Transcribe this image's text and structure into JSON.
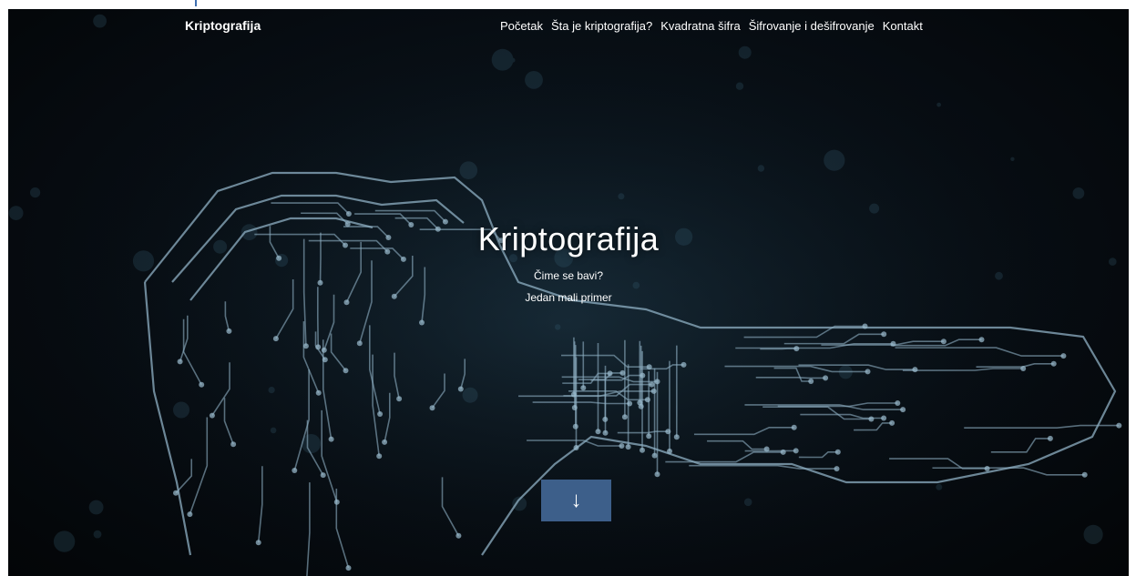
{
  "navbar": {
    "brand": "Kriptografija",
    "links": [
      {
        "label": "Početak"
      },
      {
        "label": "Šta je kriptografija?"
      },
      {
        "label": "Kvadratna šifra"
      },
      {
        "label": "Šifrovanje i dešifrovanje"
      },
      {
        "label": "Kontakt"
      }
    ]
  },
  "hero": {
    "title": "Kriptografija",
    "links": [
      {
        "label": "Čime se bavi?"
      },
      {
        "label": "Jedan mali primer"
      }
    ],
    "scroll_button_icon": "arrow-down-icon"
  },
  "colors": {
    "background": "#070d13",
    "circuit": "#8fb0c4",
    "button": "#3d5f8a",
    "text": "#ffffff",
    "top_accent": "#3f6fb0"
  }
}
